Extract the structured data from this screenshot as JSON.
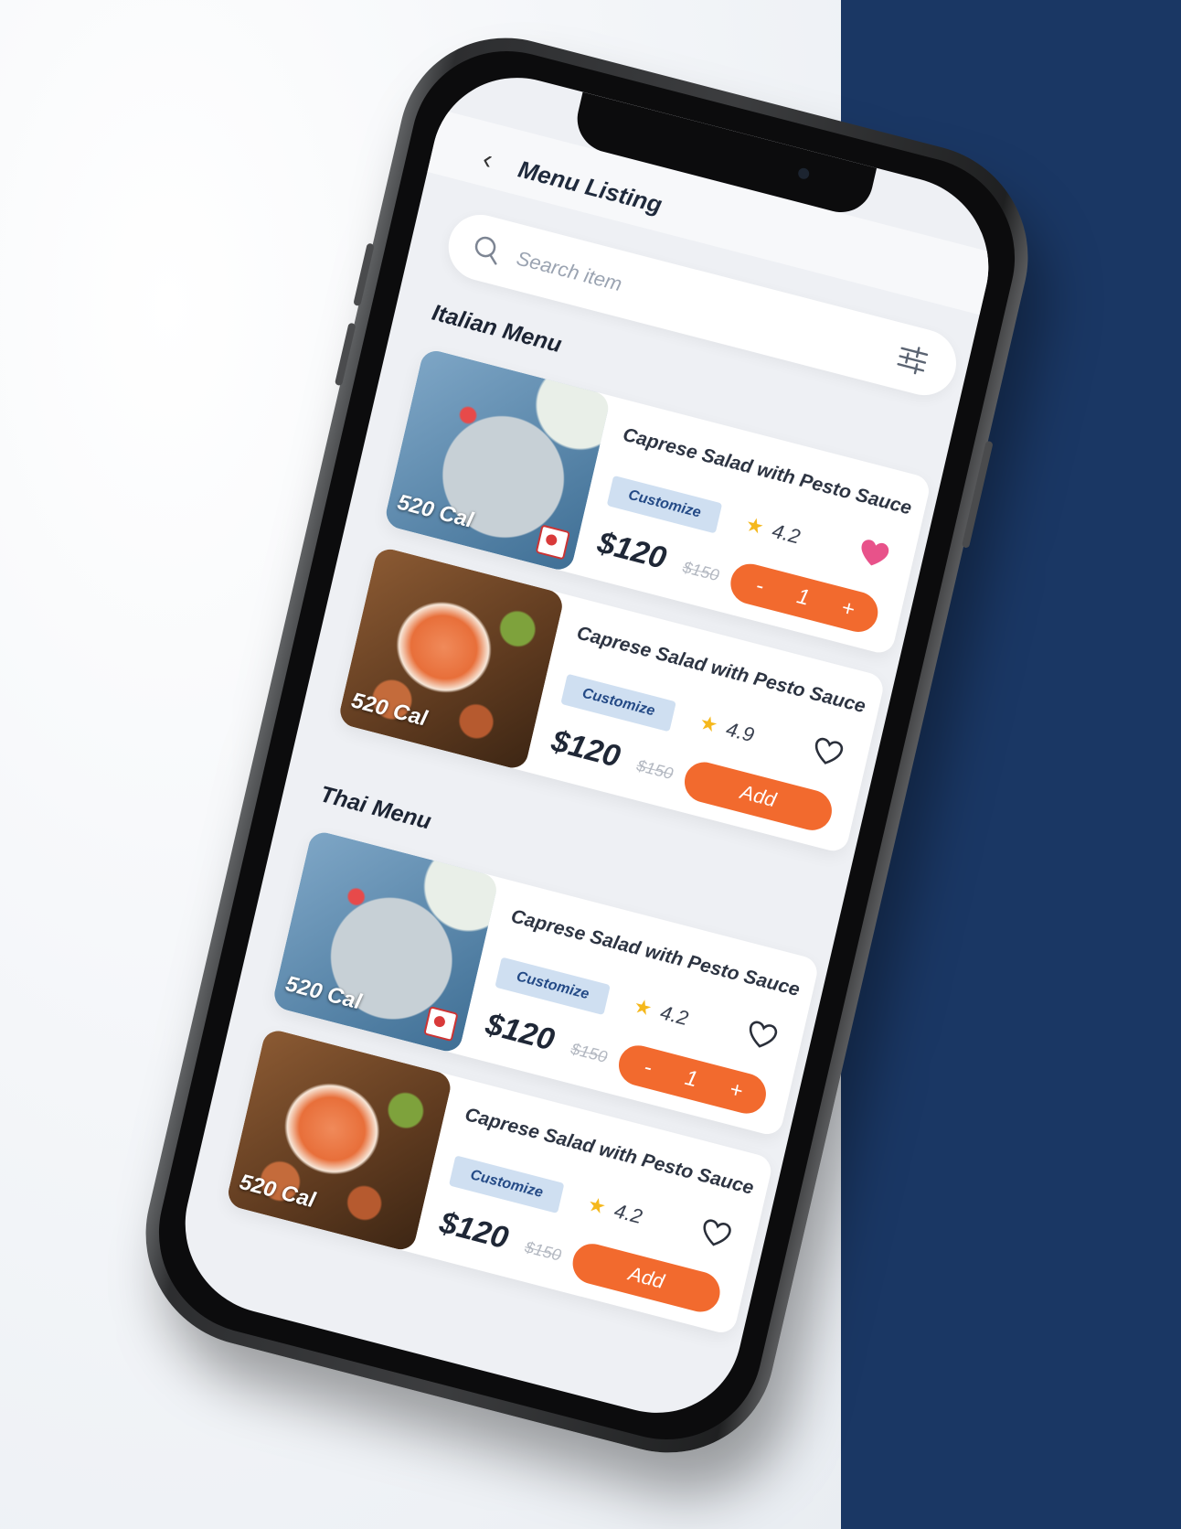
{
  "header": {
    "title": "Menu Listing"
  },
  "search": {
    "placeholder": "Search item"
  },
  "colors": {
    "accent": "#f26a2e",
    "brand_blue": "#1a3764",
    "favorite": "#e8528a"
  },
  "sections": [
    {
      "title": "Italian Menu",
      "items": [
        {
          "name": "Caprese Salad with Pesto Sauce",
          "customize": "Customize",
          "rating": "4.2",
          "price": "$120",
          "old_price": "$150",
          "calories": "520 Cal",
          "favorite": true,
          "quantity": "1",
          "stepper_minus": "-",
          "stepper_plus": "+"
        },
        {
          "name": "Caprese Salad with Pesto Sauce",
          "customize": "Customize",
          "rating": "4.9",
          "price": "$120",
          "old_price": "$150",
          "calories": "520 Cal",
          "favorite": false,
          "add_label": "Add"
        }
      ]
    },
    {
      "title": "Thai Menu",
      "items": [
        {
          "name": "Caprese Salad with Pesto Sauce",
          "customize": "Customize",
          "rating": "4.2",
          "price": "$120",
          "old_price": "$150",
          "calories": "520 Cal",
          "favorite": false,
          "quantity": "1",
          "stepper_minus": "-",
          "stepper_plus": "+"
        },
        {
          "name": "Caprese Salad with Pesto Sauce",
          "customize": "Customize",
          "rating": "4.2",
          "price": "$120",
          "old_price": "$150",
          "calories": "520 Cal",
          "favorite": false,
          "add_label": "Add"
        }
      ]
    }
  ]
}
